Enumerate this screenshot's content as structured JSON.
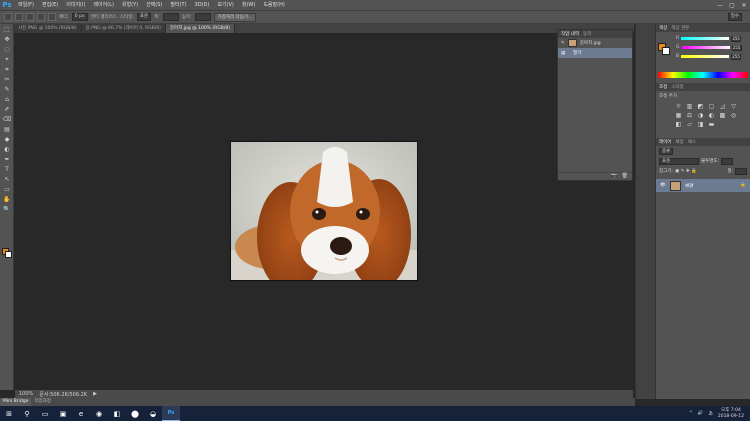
{
  "app": {
    "logo": "Ps"
  },
  "menu": [
    "파일(F)",
    "편집(E)",
    "이미지(I)",
    "레이어(L)",
    "유형(Y)",
    "선택(S)",
    "필터(T)",
    "3D(D)",
    "보기(V)",
    "창(W)",
    "도움말(H)"
  ],
  "window_controls": [
    "—",
    "▢",
    "✕"
  ],
  "options": {
    "feather_label": "페더:",
    "feather_value": "0 px",
    "antialias_label": "앤티 앨리어스",
    "style_label": "스타일:",
    "style_value": "표준",
    "width_label": "폭:",
    "height_label": "높이:",
    "refine_label": "가장자리 다듬기...",
    "workspace": "필수"
  },
  "tabs": [
    {
      "label": "사진.PNG @ 100% (RGB/8)",
      "active": false
    },
    {
      "label": "용.PNG @ 66.7% (레이어 0, RGB/8)",
      "active": false
    },
    {
      "label": "강아지.jpg @ 100% (RGB/8)",
      "active": true
    }
  ],
  "tools": [
    "⬚",
    "✥",
    "◌",
    "⌖",
    "⌗",
    "✂",
    "✎",
    "⌂",
    "✐",
    "⌫",
    "▤",
    "◆",
    "◐",
    "✒",
    "T",
    "↖",
    "▭",
    "✋",
    "🔍"
  ],
  "status": {
    "zoom": "100%",
    "doc": "문서:506.2K/506.2K"
  },
  "mini_bridge": {
    "tabs": [
      "Mini Bridge",
      "작업과정"
    ]
  },
  "history": {
    "tabs": [
      "작업 내역",
      "동작"
    ],
    "snapshot_label": "강아지.jpg",
    "items": [
      "열기"
    ],
    "footer_icons": [
      "📷",
      "🗑"
    ]
  },
  "color_panel": {
    "tabs": [
      "색상",
      "색상 견본"
    ],
    "channels": [
      {
        "label": "R",
        "value": "255",
        "gradient": "linear-gradient(to right,#0ff,#fff)"
      },
      {
        "label": "G",
        "value": "255",
        "gradient": "linear-gradient(to right,#f0f,#fff)"
      },
      {
        "label": "B",
        "value": "255",
        "gradient": "linear-gradient(to right,#ff0,#fff)"
      }
    ],
    "foreground": "#e88a1a",
    "background": "#ffffff"
  },
  "adjustments": {
    "tabs": [
      "조정",
      "스타일"
    ],
    "title": "조정 추가",
    "icons": [
      "☼",
      "▥",
      "◩",
      "▢",
      "◿",
      "▽",
      "▦",
      "⚖",
      "◑",
      "◐",
      "▩",
      "◎",
      "◧",
      "▱",
      "◨",
      "▬"
    ]
  },
  "layers": {
    "tabs": [
      "레이어",
      "채널",
      "패스"
    ],
    "kind_label": "종류",
    "blend": "표준",
    "opacity_label": "불투명도:",
    "opacity_value": "",
    "lock_label": "잠그기:",
    "fill_label": "칠:",
    "layer_name": "배경"
  },
  "taskbar": {
    "apps": [
      "⊞",
      "⚲",
      "▭",
      "▣",
      "e",
      "◉",
      "◧",
      "⬤",
      "◒",
      "Ps"
    ],
    "tray": [
      "^",
      "🔊",
      "あ"
    ],
    "time": "오후 7:04",
    "date": "2018-09-12"
  }
}
